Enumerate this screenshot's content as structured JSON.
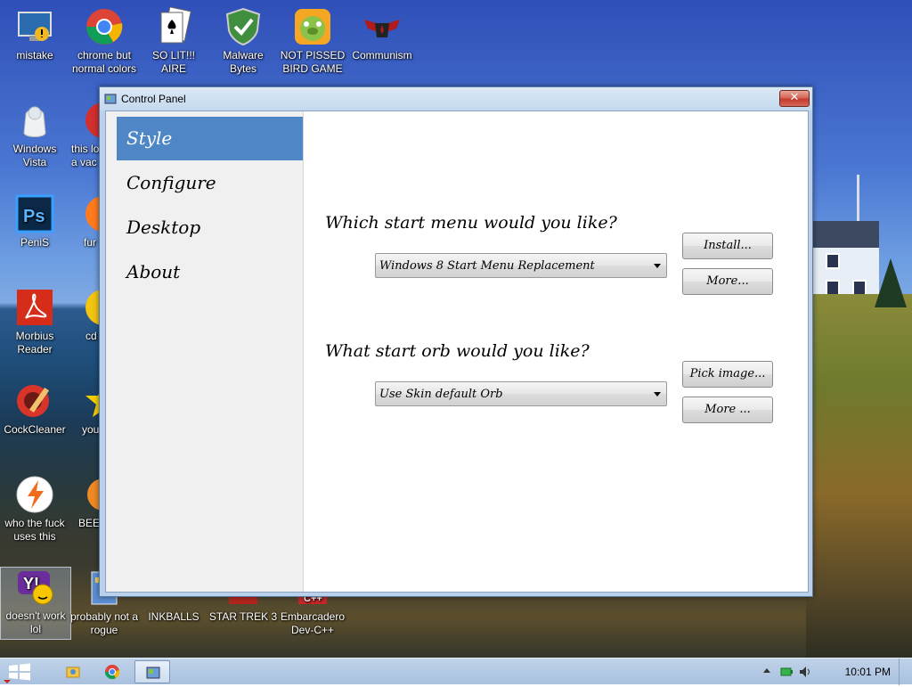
{
  "desktop": {
    "icons": [
      {
        "label": "mistake",
        "icon": "monitor-icon"
      },
      {
        "label": "chrome but normal colors",
        "icon": "chrome-icon"
      },
      {
        "label": "SO LIT!!! AIRE",
        "icon": "solitaire-icon"
      },
      {
        "label": "Malware Bytes",
        "icon": "shield-icon"
      },
      {
        "label": "NOT PISSED BIRD GAME",
        "icon": "pig-icon"
      },
      {
        "label": "Communism",
        "icon": "emblem-icon"
      },
      {
        "label": "Windows Vista",
        "icon": "vista-icon"
      },
      {
        "label": "this lo a vac",
        "icon": "red-ball-icon"
      },
      {
        "label": "PeniS",
        "icon": "photoshop-icon"
      },
      {
        "label": "fur",
        "icon": "firefox-icon"
      },
      {
        "label": "Morbius Reader",
        "icon": "acrobat-icon"
      },
      {
        "label": "cd",
        "icon": "cd-icon"
      },
      {
        "label": "CockCleaner",
        "icon": "ccleaner-icon"
      },
      {
        "label": "you",
        "icon": "star-icon"
      },
      {
        "label": "who the fuck uses this",
        "icon": "winamp-icon"
      },
      {
        "label": "BEE",
        "icon": "bee-icon"
      },
      {
        "label": "doesn't work lol",
        "icon": "yahoo-messenger-icon"
      },
      {
        "label": "probably not a rogue",
        "icon": "rogue-icon"
      },
      {
        "label": "INKBALLS",
        "icon": "inkballs-icon"
      },
      {
        "label": "STAR TREK 3",
        "icon": "startrek-icon"
      },
      {
        "label": "Embarcadero Dev-C++",
        "icon": "devcpp-icon"
      }
    ]
  },
  "window": {
    "title": "Control Panel",
    "close_label": "✕",
    "nav": [
      {
        "label": "Style"
      },
      {
        "label": "Configure"
      },
      {
        "label": "Desktop"
      },
      {
        "label": "About"
      }
    ],
    "start_menu": {
      "question": "Which start menu would you like?",
      "selected": "Windows 8 Start Menu Replacement",
      "install_label": "Install...",
      "more_label": "More..."
    },
    "start_orb": {
      "question": "What start orb would you like?",
      "selected": "Use Skin default Orb",
      "pick_label": "Pick image...",
      "more_label": "More ..."
    }
  },
  "taskbar": {
    "clock": "10:01 PM",
    "items": [
      "start-button",
      "explorer",
      "chrome",
      "control-panel"
    ]
  }
}
